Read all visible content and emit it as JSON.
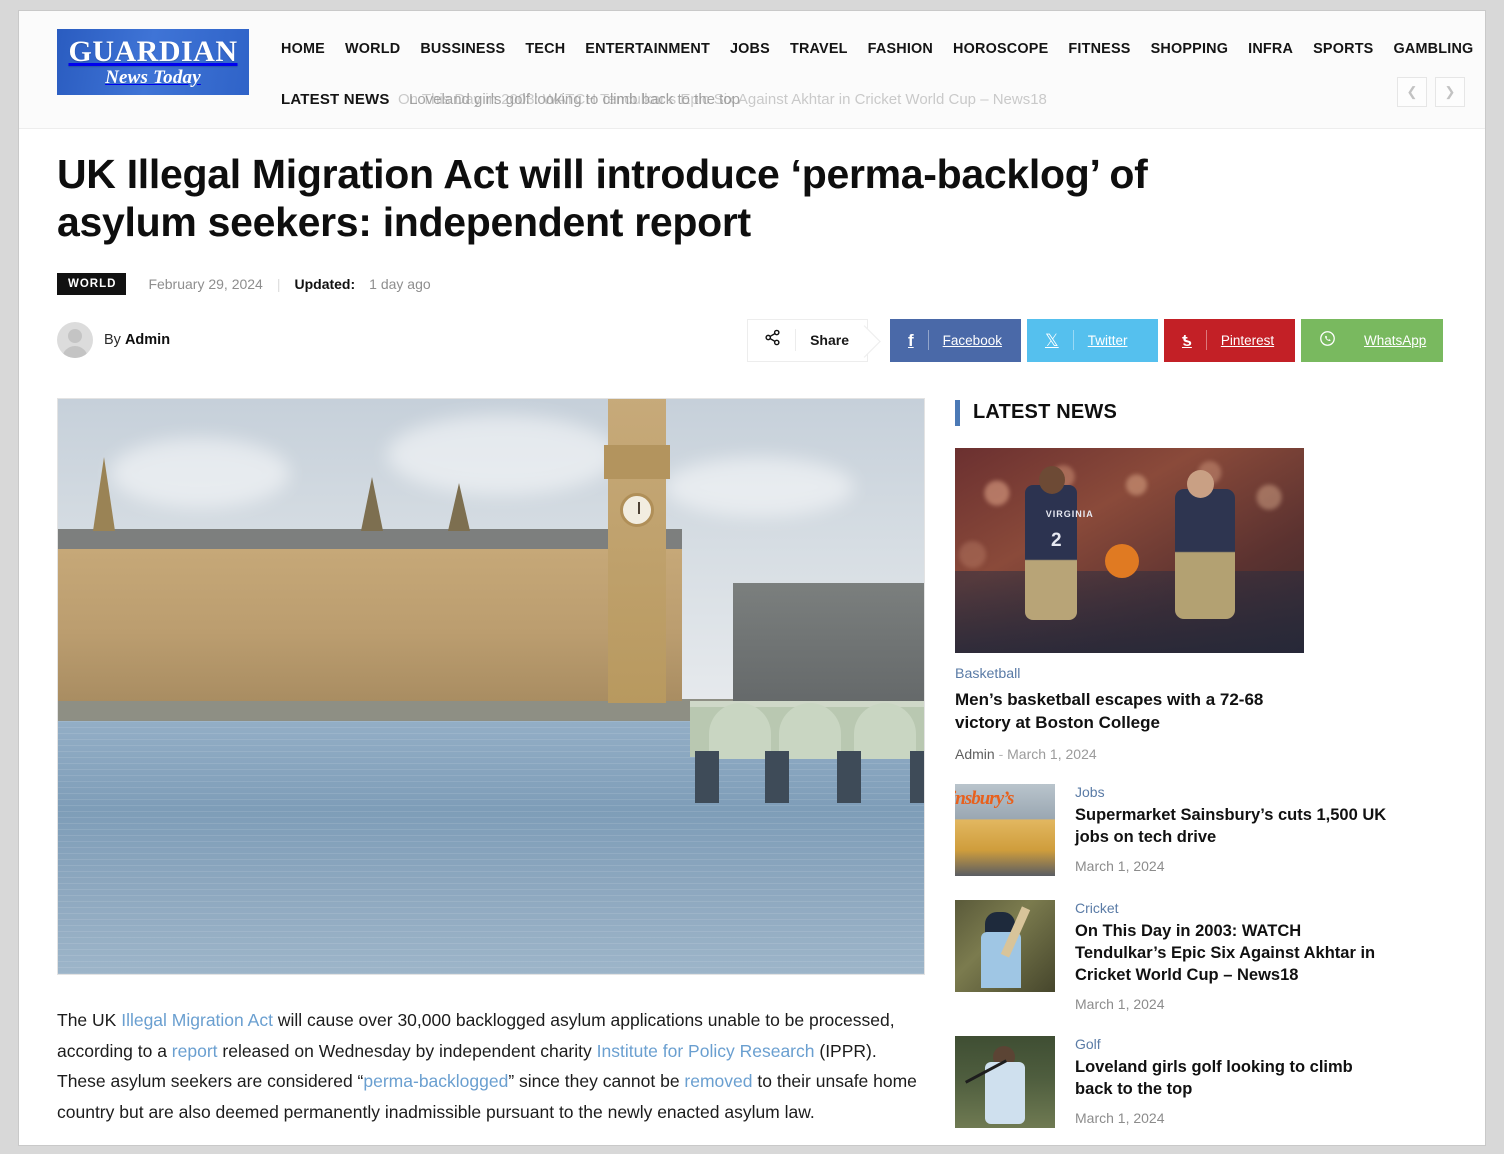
{
  "site": {
    "logo_main": "GUARDIAN",
    "logo_sub": "News Today",
    "brand_color": "#3f74d6"
  },
  "nav": {
    "items": [
      {
        "label": "HOME"
      },
      {
        "label": "WORLD"
      },
      {
        "label": "BUSSINESS"
      },
      {
        "label": "TECH"
      },
      {
        "label": "ENTERTAINMENT"
      },
      {
        "label": "JOBS"
      },
      {
        "label": "TRAVEL"
      },
      {
        "label": "FASHION"
      },
      {
        "label": "HOROSCOPE"
      },
      {
        "label": "FITNESS"
      },
      {
        "label": "SHOPPING"
      },
      {
        "label": "INFRA"
      },
      {
        "label": "SPORTS"
      },
      {
        "label": "GAMBLING"
      }
    ]
  },
  "ticker": {
    "label": "LATEST NEWS",
    "item_fading": "On This Day in 2003: WATCH Tendulkar’s Epic Six Against Akhtar in Cricket World Cup – News18",
    "item_active": "Loveland girls golf looking to climb back to the top",
    "prev_icon": "chevron-left-icon",
    "next_icon": "chevron-right-icon"
  },
  "article": {
    "headline": "UK Illegal Migration Act will introduce ‘perma-backlog’ of asylum seekers: independent report",
    "category": "WORLD",
    "date": "February 29, 2024",
    "separator": "|",
    "updated_label": "Updated:",
    "updated_value": "1 day ago",
    "author_prefix": "By",
    "author": "Admin",
    "hero_alt": "Houses of Parliament and Big Ben beside the River Thames",
    "body": {
      "p1_part1": "The UK ",
      "link1": "Illegal Migration Act",
      "p1_part2": " will cause over 30,000 backlogged asylum applications unable to be processed, according to a ",
      "link2": "report",
      "p1_part3": " released on Wednesday by independent charity ",
      "link3": "Institute for Policy Research",
      "p1_part4": " (IPPR). These asylum seekers are considered “",
      "link4": "perma-backlogged",
      "p1_part5": "” since they cannot be ",
      "link5": "removed",
      "p1_part6": " to their unsafe home country but are also deemed permanently inadmissible pursuant to the newly enacted asylum law."
    }
  },
  "share": {
    "icon": "share-icon",
    "label": "Share",
    "buttons": [
      {
        "label": "Facebook",
        "glyph": "f",
        "color": "#4a69a8",
        "icon": "facebook-icon"
      },
      {
        "label": "Twitter",
        "glyph": "𝕏",
        "color": "#55c0ee",
        "icon": "twitter-x-icon"
      },
      {
        "label": "Pinterest",
        "glyph": "ƿ",
        "color": "#c32026",
        "icon": "pinterest-icon"
      },
      {
        "label": "WhatsApp",
        "glyph": "✆",
        "color": "#79b95f",
        "icon": "whatsapp-icon"
      }
    ]
  },
  "sidebar": {
    "title": "LATEST NEWS",
    "accent_color": "#4b79b5",
    "featured": {
      "kicker": "Basketball",
      "headline": "Men’s basketball escapes with a 72-68 victory at Boston College",
      "author": "Admin",
      "dash": "-",
      "date": "March 1, 2024",
      "image_alt": "Virginia basketball player number 2 and coach on sideline"
    },
    "items": [
      {
        "kicker": "Jobs",
        "headline": "Supermarket Sainsbury’s cuts 1,500 UK jobs on tech drive",
        "date": "March 1, 2024",
        "image_alt": "Sainsbury's storefront",
        "thumb_class": "th-sains",
        "thumb_word": "insbury’s"
      },
      {
        "kicker": "Cricket",
        "headline": "On This Day in 2003: WATCH Tendulkar’s Epic Six Against Akhtar in Cricket World Cup – News18",
        "date": "March 1, 2024",
        "image_alt": "Cricket batsman playing a shot",
        "thumb_class": "th-cricket",
        "thumb_word": ""
      },
      {
        "kicker": "Golf",
        "headline": "Loveland girls golf looking to climb back to the top",
        "date": "March 1, 2024",
        "image_alt": "Golfer swinging a club",
        "thumb_class": "th-golf",
        "thumb_word": ""
      }
    ]
  }
}
